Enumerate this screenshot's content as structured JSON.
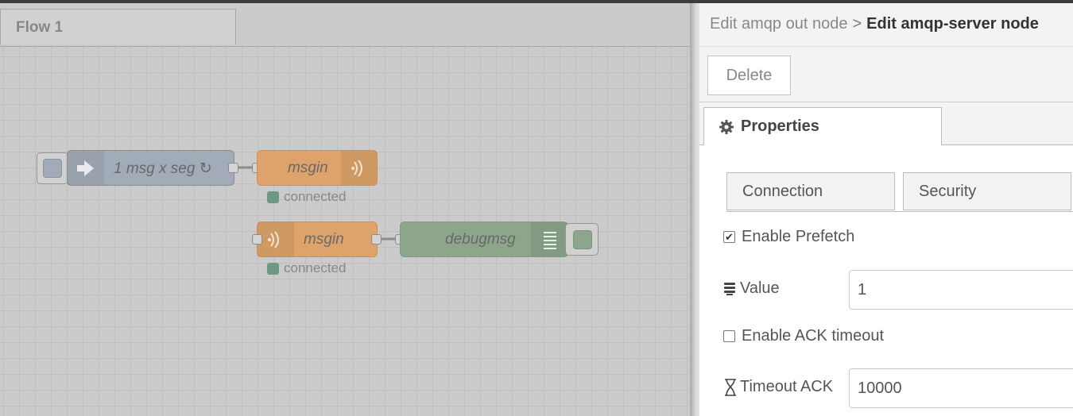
{
  "workspace": {
    "flow_tab": "Flow 1",
    "nodes": {
      "inject": {
        "label": "1 msg x seg ↻"
      },
      "amqp_out": {
        "label": "msgin",
        "status": "connected"
      },
      "amqp_in": {
        "label": "msgin",
        "status": "connected"
      },
      "debug": {
        "label": "debugmsg"
      }
    }
  },
  "tray": {
    "breadcrumb": {
      "parent": "Edit amqp out node",
      "separator": ">",
      "current": "Edit amqp-server node"
    },
    "delete_label": "Delete",
    "properties_tab": "Properties",
    "subtabs": [
      "Connection",
      "Security"
    ],
    "prefetch": {
      "label": "Enable Prefetch",
      "checked": true
    },
    "value": {
      "label": "Value",
      "value": "1"
    },
    "ack_timeout": {
      "label": "Enable ACK timeout",
      "checked": false
    },
    "timeout_ack": {
      "label": "Timeout ACK",
      "value": "10000"
    }
  },
  "colors": {
    "inject": "#a6b0bc",
    "amqp": "#e2a76e",
    "debug": "#8fa98e",
    "status_green": "#6f9c87"
  }
}
